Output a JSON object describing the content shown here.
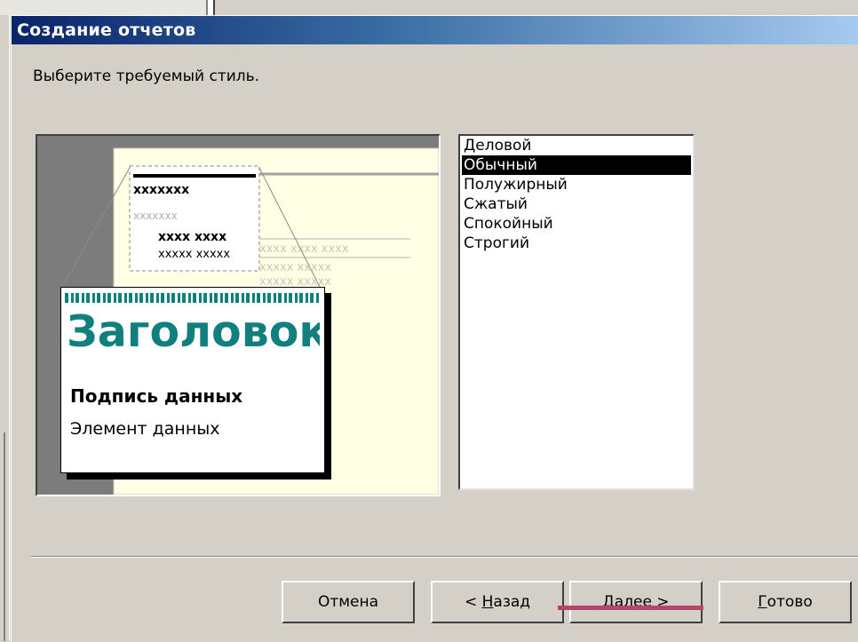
{
  "window": {
    "title": "Создание отчетов"
  },
  "instruction": "Выберите требуемый стиль.",
  "preview": {
    "sample_heading": "Заголовок",
    "sample_label": "Подпись данных",
    "sample_item": "Элемент данных",
    "placeholder_header": "xxxxxxx",
    "placeholder_sub": "xxxxxxx",
    "placeholder_row1": "xxxx xxxx",
    "placeholder_row2": "xxxxx xxxxx",
    "placeholder_faint": "xxxx xxxx xxxx",
    "placeholder_faint_row": "xxxxx xxxxx"
  },
  "styles": {
    "items": [
      "Деловой",
      "Обычный",
      "Полужирный",
      "Сжатый",
      "Спокойный",
      "Строгий"
    ],
    "selected": "Обычный"
  },
  "buttons": {
    "cancel": "Отмена",
    "back_prefix": "< ",
    "back_mnemonic": "Н",
    "back_rest": "азад",
    "next_mnemonic": "Д",
    "next_rest": "алее >",
    "finish_mnemonic": "Г",
    "finish_rest": "отово"
  },
  "colors": {
    "title_gradient_start": "#0a246a",
    "selection": "#000000",
    "accent_teal": "#127f7f",
    "highlight": "#b4456c"
  }
}
